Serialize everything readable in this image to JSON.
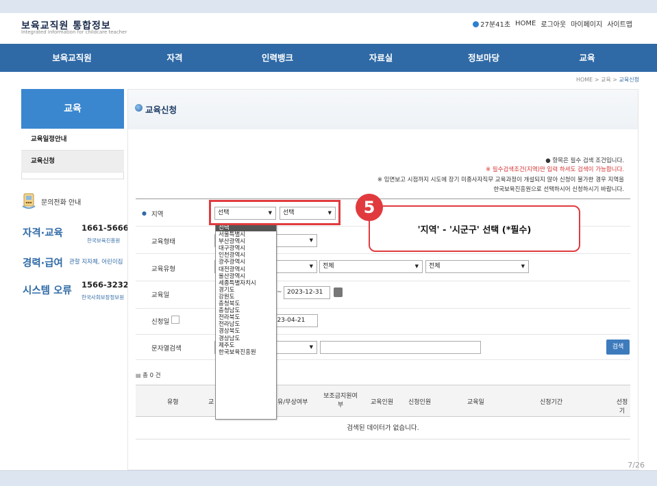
{
  "header": {
    "title": "보육교직원 통합정보",
    "subtitle": "Integrated Information for childcare teacher",
    "util": [
      "27분41초",
      "HOME",
      "로그아웃",
      "마이페이지",
      "사이트맵"
    ]
  },
  "nav": [
    "보육교직원",
    "자격",
    "인력뱅크",
    "자료실",
    "정보마당",
    "교육"
  ],
  "breadcrumb": {
    "home": "HOME",
    "sep1": ">",
    "parent": "교육",
    "sep2": ">",
    "current": "교육신청"
  },
  "sidebar": {
    "title": "교육",
    "items": [
      "교육일정안내",
      "교육신청"
    ],
    "phone_title": "문의전화 안내",
    "phones": [
      {
        "category": "자격·교육",
        "number": "1661-5666",
        "org": "한국보육진흥원"
      },
      {
        "category": "경력·급여",
        "number": "",
        "org": "관할 지자체, 어린이집"
      },
      {
        "category": "시스템 오류",
        "number": "1566-3232",
        "org": "한국사회보장정보원"
      }
    ]
  },
  "main": {
    "title": "교육신청",
    "notes": [
      "● 항목은 필수 검색 조건입니다.",
      "※ 필수검색조건(지역)만 입력 하셔도 검색이 가능합니다.",
      "※ 임면보고 시점까지 시도에 장기 미종사자직무 교육과정이 개설되지 않아 신청이 불가한 경우 지역을",
      "한국보육진흥원으로 선택하시어 신청하시기 바랍니다."
    ],
    "form": {
      "region_label": "지역",
      "region_value": "선택",
      "district_value": "선택",
      "type_label": "교육형태",
      "category_label": "교육유형",
      "category_value2": "전체",
      "category_value3": "전체",
      "date_label": "교육일",
      "date_sep": "~",
      "date_end": "2023-12-31",
      "apply_label": "신청일",
      "apply_date": "2023-04-21",
      "keyword_label": "문자열검색",
      "search_button": "검색"
    },
    "result_count": "총 0 건",
    "table_headers": [
      "유형",
      "교",
      "유/무상여부",
      "보조금지원여부",
      "교육인원",
      "신청인원",
      "교육일",
      "신청기간",
      "선정기"
    ],
    "empty_message": "검색된 데이터가 없습니다."
  },
  "dropdown_options": [
    "선택",
    "서울특별시",
    "부산광역시",
    "대구광역시",
    "인천광역시",
    "광주광역시",
    "대전광역시",
    "울산광역시",
    "세종특별자치시",
    "경기도",
    "강원도",
    "충청북도",
    "충청남도",
    "전라북도",
    "전라남도",
    "경상북도",
    "경상남도",
    "제주도",
    "한국보육진흥원"
  ],
  "annotation": {
    "step": "5",
    "text": "'지역' - '시군구' 선택 (*필수)"
  },
  "page_number": "7/26",
  "colors": {
    "nav": "#2f6aa6",
    "accent_red": "#e03a3e",
    "side_head": "#3a87d0"
  }
}
